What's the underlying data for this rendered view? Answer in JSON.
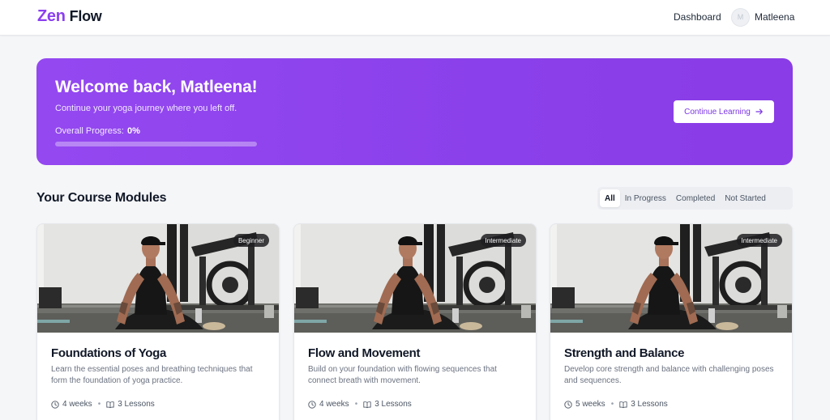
{
  "brand": {
    "first": "Zen",
    "second": "Flow",
    "accent": "#8b3ff0"
  },
  "nav": {
    "dashboard": "Dashboard",
    "user_name": "Matleena",
    "avatar_initial": "M"
  },
  "hero": {
    "title": "Welcome back, Matleena!",
    "subtitle": "Continue your yoga journey where you left off.",
    "progress_label": "Overall Progress:",
    "progress_value": "0%",
    "progress_fraction": 0,
    "button_label": "Continue Learning",
    "gradient_start": "#9448f0",
    "gradient_end": "#8a3ce6"
  },
  "modules": {
    "title": "Your Course Modules",
    "filters": [
      "All",
      "In Progress",
      "Completed",
      "Not Started"
    ],
    "active_filter": "All",
    "cards": [
      {
        "level": "Beginner",
        "title": "Foundations of Yoga",
        "description": "Learn the essential poses and breathing techniques that form the foundation of yoga practice.",
        "duration": "4 weeks",
        "lessons": "3 Lessons"
      },
      {
        "level": "Intermediate",
        "title": "Flow and Movement",
        "description": "Build on your foundation with flowing sequences that connect breath with movement.",
        "duration": "4 weeks",
        "lessons": "3 Lessons"
      },
      {
        "level": "Intermediate",
        "title": "Strength and Balance",
        "description": "Develop core strength and balance with challenging poses and sequences.",
        "duration": "5 weeks",
        "lessons": "3 Lessons"
      }
    ]
  },
  "icons": {
    "clock": "clock-icon",
    "book": "book-icon",
    "arrow": "arrow-right-icon"
  }
}
